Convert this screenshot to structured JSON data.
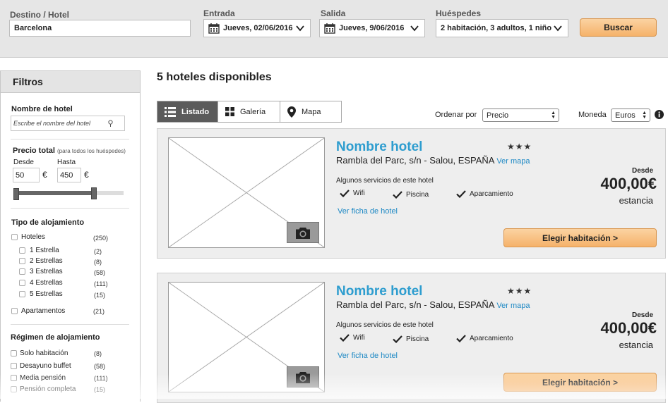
{
  "search": {
    "destino_label": "Destino / Hotel",
    "destino_value": "Barcelona",
    "entrada_label": "Entrada",
    "entrada_value": "Jueves, 02/06/2016",
    "salida_label": "Salida",
    "salida_value": "Jueves, 9/06/2016",
    "huespedes_label": "Huéspedes",
    "huespedes_value": "2 habitación, 3 adultos, 1 niño",
    "buscar_label": "Buscar"
  },
  "filters": {
    "title": "Filtros",
    "hotel_name_label": "Nombre de hotel",
    "hotel_name_placeholder": "Escribe el nombre del hotel",
    "price_label": "Precio total",
    "price_note": "(para todos los huéspedes)",
    "desde_label": "Desde",
    "hasta_label": "Hasta",
    "desde_value": "50",
    "hasta_value": "450",
    "currency_symbol": "€",
    "tipo_label": "Tipo de alojamiento",
    "tipo_items": [
      {
        "label": "Hoteles",
        "count": "(250)"
      },
      {
        "label": "1 Estrella",
        "count": "(2)"
      },
      {
        "label": "2 Estrellas",
        "count": "(8)"
      },
      {
        "label": "3 Estrellas",
        "count": "(58)"
      },
      {
        "label": "4 Estrellas",
        "count": "(111)"
      },
      {
        "label": "5 Estrellas",
        "count": "(15)"
      },
      {
        "label": "Apartamentos",
        "count": "(21)"
      }
    ],
    "regimen_label": "Régimen de alojamiento",
    "regimen_items": [
      {
        "label": "Solo habitación",
        "count": "(8)"
      },
      {
        "label": "Desayuno buffet",
        "count": "(58)"
      },
      {
        "label": "Media pensión",
        "count": "(111)"
      },
      {
        "label": "Pensión completa",
        "count": "(15)"
      }
    ]
  },
  "results": {
    "title": "5 hoteles disponibles",
    "tabs": [
      "Listado",
      "Galería",
      "Mapa"
    ],
    "active_tab": "Listado",
    "sort_label": "Ordenar por",
    "sort_value": "Precio",
    "currency_label": "Moneda",
    "currency_value": "Euros"
  },
  "hotels": [
    {
      "name": "Nombre hotel",
      "stars": "★★★",
      "address": "Rambla del Parc, s/n - Salou, ESPAÑA",
      "map_link": "Ver mapa",
      "services_title": "Algunos servicios de este hotel",
      "services": [
        "Wifi",
        "Piscina",
        "Aparcamiento"
      ],
      "detail_link": "Ver ficha de hotel",
      "price_from": "Desde",
      "price": "400,00€",
      "price_unit": "estancia",
      "cta": "Elegir habitación >"
    },
    {
      "name": "Nombre hotel",
      "stars": "★★★",
      "address": "Rambla del Parc, s/n - Salou, ESPAÑA",
      "map_link": "Ver mapa",
      "services_title": "Algunos servicios de este hotel",
      "services": [
        "Wifi",
        "Piscina",
        "Aparcamiento"
      ],
      "detail_link": "Ver ficha de hotel",
      "price_from": "Desde",
      "price": "400,00€",
      "price_unit": "estancia",
      "cta": "Elegir habitación >"
    }
  ],
  "colors": {
    "accent_blue": "#2e9dcf",
    "button_orange": "#f5b26a",
    "tab_active": "#5b5b5b"
  }
}
